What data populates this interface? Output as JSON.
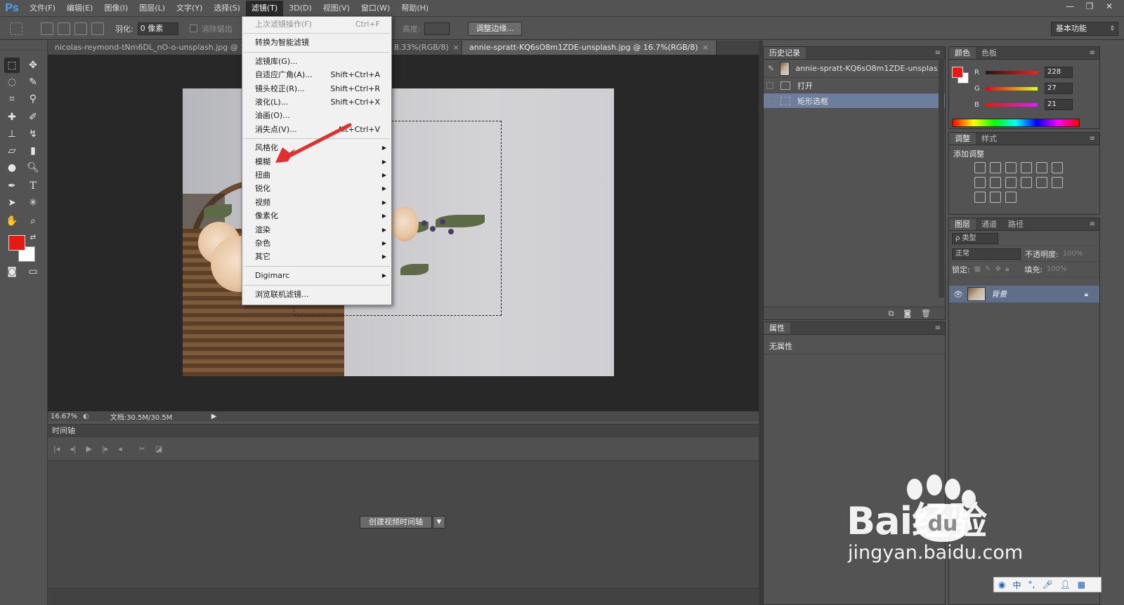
{
  "app": {
    "logo": "Ps",
    "menu": [
      "文件(F)",
      "编辑(E)",
      "图像(I)",
      "图层(L)",
      "文字(Y)",
      "选择(S)",
      "滤镜(T)",
      "3D(D)",
      "视图(V)",
      "窗口(W)",
      "帮助(H)"
    ],
    "active_menu_index": 6,
    "window_buttons": [
      "—",
      "❐",
      "✕"
    ]
  },
  "options": {
    "feather_label": "羽化:",
    "feather_value": "0 像素",
    "antialias_label": "消除锯齿",
    "height_label": "高度:",
    "refine_edge": "调整边缘...",
    "workspace": "基本功能"
  },
  "tabs": [
    {
      "label": "nicolas-reymond-tNm6DL_nO-o-unsplash.jpg @ 12.5",
      "active": false
    },
    {
      "label": "nsplash.jpg @ 8.33%(RGB/8)",
      "active": false
    },
    {
      "label": "annie-spratt-KQ6sO8m1ZDE-unsplash.jpg @ 16.7%(RGB/8)",
      "active": true
    }
  ],
  "tab_close": "×",
  "status": {
    "zoom": "16.67%",
    "doc": "文档:30.5M/30.5M"
  },
  "timeline": {
    "title": "时间轴",
    "create_button": "创建视频时间轴"
  },
  "filter_menu": {
    "items": [
      {
        "label": "上次滤镜操作(F)",
        "shortcut": "Ctrl+F",
        "disabled": true
      },
      {
        "sep": true
      },
      {
        "label": "转换为智能滤镜"
      },
      {
        "sep": true
      },
      {
        "label": "滤镜库(G)..."
      },
      {
        "label": "自适应广角(A)...",
        "shortcut": "Shift+Ctrl+A"
      },
      {
        "label": "镜头校正(R)...",
        "shortcut": "Shift+Ctrl+R"
      },
      {
        "label": "液化(L)...",
        "shortcut": "Shift+Ctrl+X"
      },
      {
        "label": "油画(O)..."
      },
      {
        "label": "消失点(V)...",
        "shortcut": "Alt+Ctrl+V"
      },
      {
        "sep": true
      },
      {
        "label": "风格化",
        "submenu": true
      },
      {
        "label": "模糊",
        "submenu": true
      },
      {
        "label": "扭曲",
        "submenu": true
      },
      {
        "label": "锐化",
        "submenu": true
      },
      {
        "label": "视频",
        "submenu": true
      },
      {
        "label": "像素化",
        "submenu": true
      },
      {
        "label": "渲染",
        "submenu": true
      },
      {
        "label": "杂色",
        "submenu": true
      },
      {
        "label": "其它",
        "submenu": true
      },
      {
        "sep": true
      },
      {
        "label": "Digimarc",
        "submenu": true
      },
      {
        "sep": true
      },
      {
        "label": "浏览联机滤镜..."
      }
    ]
  },
  "history": {
    "tab": "历史记录",
    "snapshot": "annie-spratt-KQ6sO8m1ZDE-unsplas...",
    "items": [
      "打开",
      "矩形选框"
    ],
    "selected_index": 1
  },
  "properties": {
    "tab": "属性",
    "body": "无属性"
  },
  "color": {
    "tabs": [
      "颜色",
      "色板"
    ],
    "fg": "#e41b15",
    "channels": [
      {
        "name": "R",
        "value": "228"
      },
      {
        "name": "G",
        "value": "27"
      },
      {
        "name": "B",
        "value": "21"
      }
    ]
  },
  "adjustments": {
    "tabs": [
      "调整",
      "样式"
    ],
    "label": "添加调整"
  },
  "layers": {
    "tabs": [
      "图层",
      "通道",
      "路径"
    ],
    "filter": "ρ 类型",
    "blend_mode": "正常",
    "opacity_label": "不透明度:",
    "opacity_value": "100%",
    "lock_label": "锁定:",
    "fill_label": "填充:",
    "fill_value": "100%",
    "layer_name": "背景"
  },
  "watermark": {
    "main": "Bai经验",
    "du": "du",
    "sub": "jingyan.baidu.com"
  },
  "ime": {
    "mode": "中"
  }
}
